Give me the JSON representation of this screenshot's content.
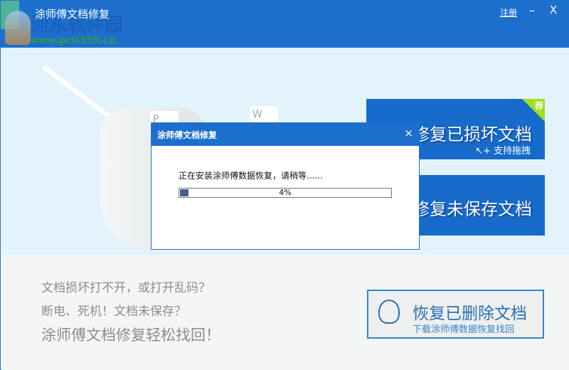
{
  "window": {
    "title": "涂师傅文档修复",
    "register": "注册",
    "minimize": "–",
    "close": "X"
  },
  "watermark": {
    "name": "河东软件园",
    "url": "www.pc0359.cn"
  },
  "cards": [
    {
      "title": "修复已损坏文档",
      "subtitle": "↖+ 支持拖拽",
      "badge": "荐"
    },
    {
      "title": "修复未保存文档"
    }
  ],
  "left_text": [
    "文档损坏打不开，或打开乱码？",
    "断电、死机！文档未保存？",
    "涂师傅文档修复轻松找回！"
  ],
  "recover_button": {
    "title": "恢复已删除文档",
    "subtitle": "下载涂师傅数据恢复找回"
  },
  "dialog": {
    "title": "涂师傅文档修复",
    "close": "×",
    "message": "正在安装涂师傅数据恢复，请稍等......",
    "progress_percent": 4,
    "progress_label": "4%"
  }
}
